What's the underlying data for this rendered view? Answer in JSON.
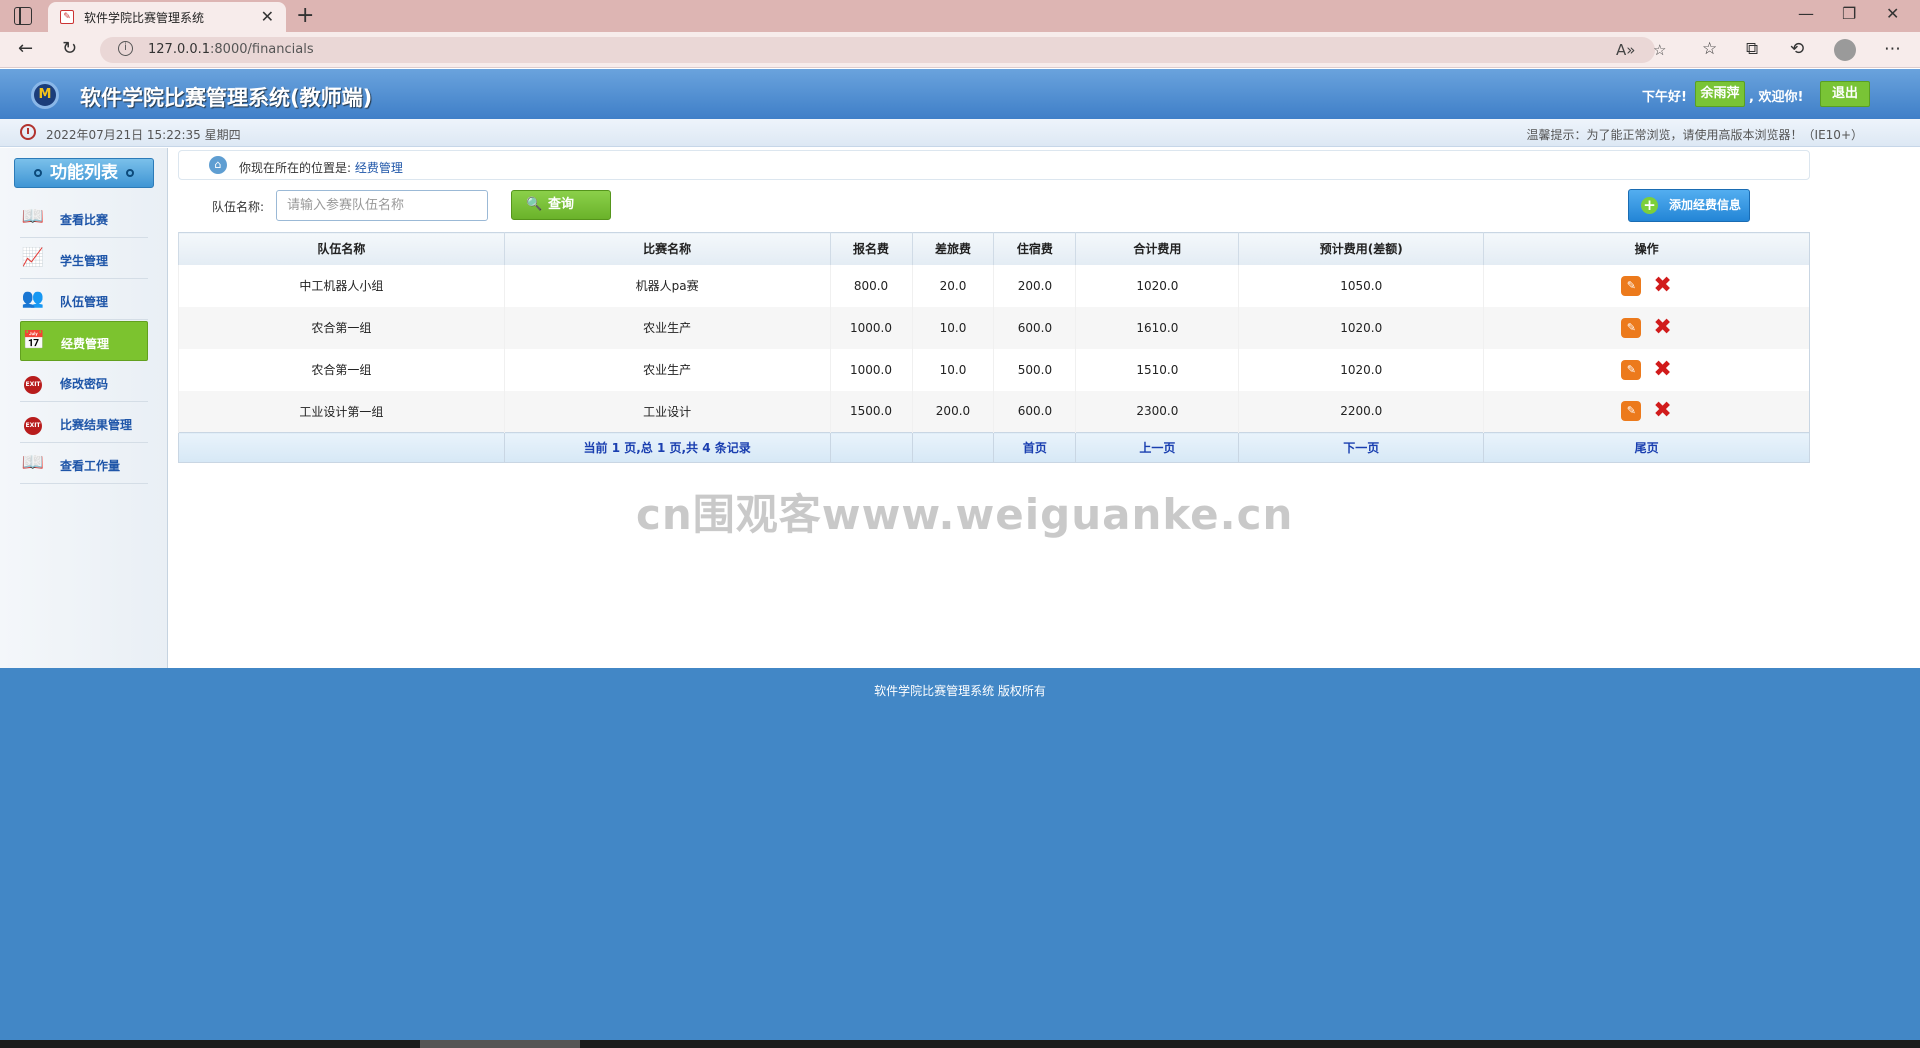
{
  "browser": {
    "tab_title": "软件学院比赛管理系统",
    "url_host": "127.0.0.1",
    "url_path": ":8000/financials"
  },
  "header": {
    "title": "软件学院比赛管理系统(教师端)",
    "greeting": "下午好!",
    "username": "余雨萍",
    "welcome": ", 欢迎你!",
    "logout": "退出"
  },
  "info_bar": {
    "datetime": "2022年07月21日 15:22:35 星期四",
    "tip": "温馨提示：为了能正常浏览，请使用高版本浏览器！（IE10+）"
  },
  "sidebar": {
    "title": "功能列表",
    "items": [
      {
        "label": "查看比赛",
        "icon": "book-icon"
      },
      {
        "label": "学生管理",
        "icon": "chart-icon"
      },
      {
        "label": "队伍管理",
        "icon": "users-icon"
      },
      {
        "label": "经费管理",
        "icon": "calendar-icon"
      },
      {
        "label": "修改密码",
        "icon": "exit-icon"
      },
      {
        "label": "比赛结果管理",
        "icon": "exit-icon"
      },
      {
        "label": "查看工作量",
        "icon": "book-icon"
      }
    ]
  },
  "breadcrumb": {
    "prefix": "你现在所在的位置是:",
    "current": "经费管理"
  },
  "search": {
    "label": "队伍名称:",
    "placeholder": "请输入参赛队伍名称",
    "query": "查询",
    "add": "添加经费信息"
  },
  "table": {
    "headers": [
      "队伍名称",
      "比赛名称",
      "报名费",
      "差旅费",
      "住宿费",
      "合计费用",
      "预计费用(差额)",
      "操作"
    ],
    "rows": [
      [
        "中工机器人小组",
        "机器人pa赛",
        "800.0",
        "20.0",
        "200.0",
        "1020.0",
        "1050.0"
      ],
      [
        "农合第一组",
        "农业生产",
        "1000.0",
        "10.0",
        "600.0",
        "1610.0",
        "1020.0"
      ],
      [
        "农合第一组",
        "农业生产",
        "1000.0",
        "10.0",
        "500.0",
        "1510.0",
        "1020.0"
      ],
      [
        "工业设计第一组",
        "工业设计",
        "1500.0",
        "200.0",
        "600.0",
        "2300.0",
        "2200.0"
      ]
    ]
  },
  "pager": {
    "summary": "当前 1 页,总 1 页,共 4 条记录",
    "first": "首页",
    "prev": "上一页",
    "next": "下一页",
    "last": "尾页"
  },
  "watermark": "cn围观客www.weiguanke.cn",
  "footer": {
    "text": "软件学院比赛管理系统 版权所有"
  }
}
